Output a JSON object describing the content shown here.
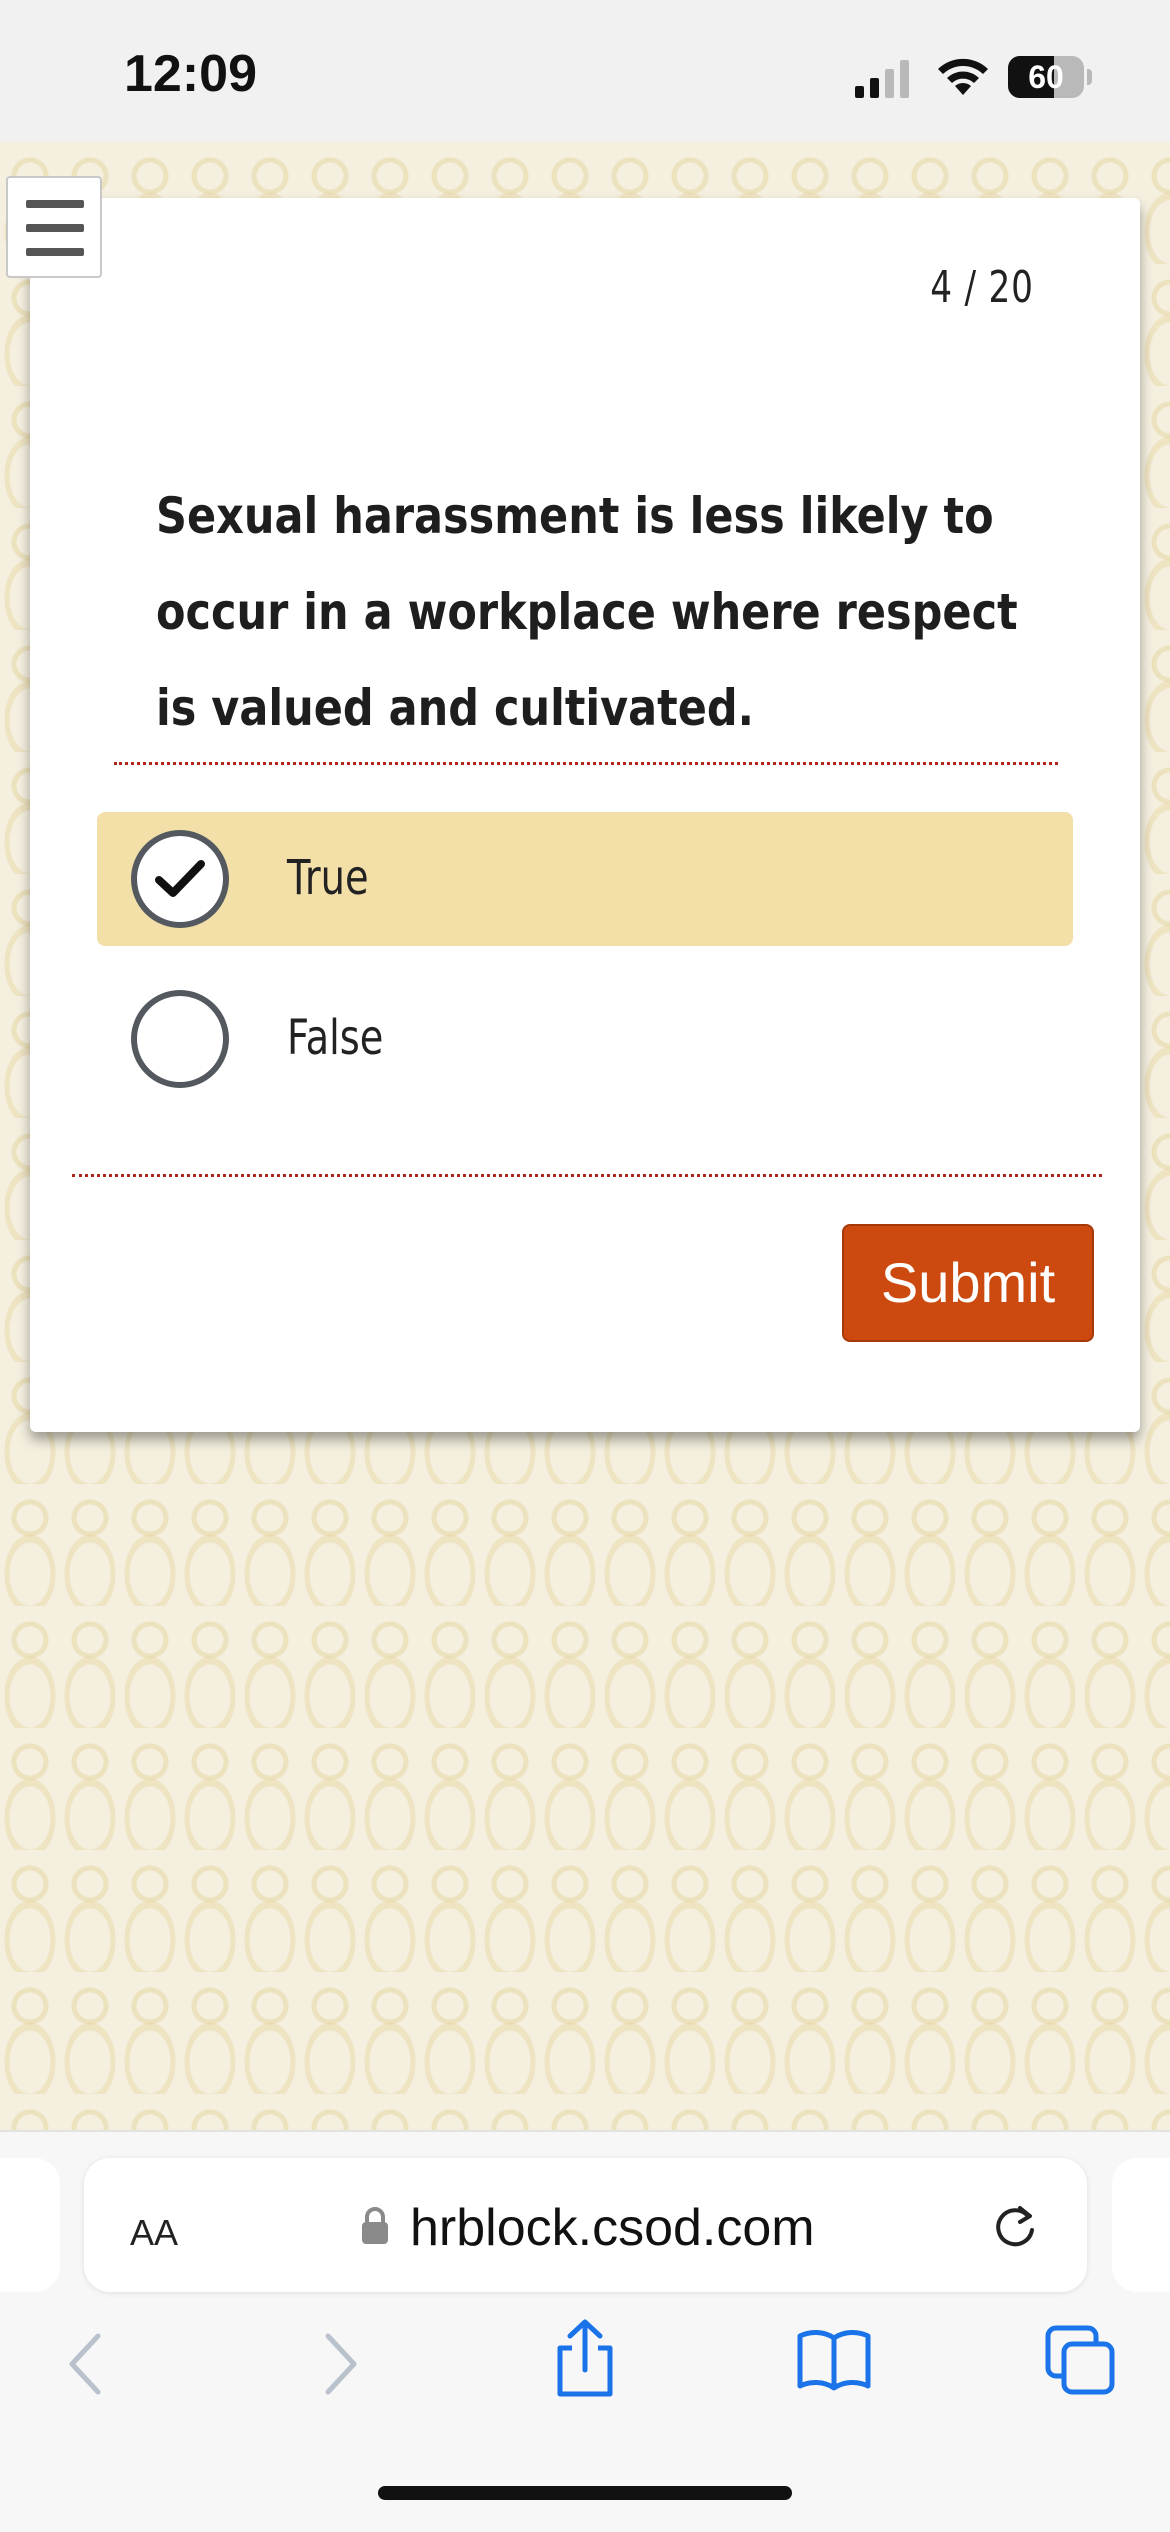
{
  "status_bar": {
    "time": "12:09",
    "battery_level": "60",
    "battery_percent": 60,
    "icons": [
      "signal-icon",
      "wifi-icon",
      "battery-icon"
    ]
  },
  "quiz": {
    "menu_icon": "hamburger-menu-icon",
    "progress": "4 / 20",
    "question_lines": [
      "Sexual harassment is less likely to",
      "occur in a workplace where respect",
      "is valued and cultivated."
    ],
    "options": [
      {
        "label": "True",
        "selected": true
      },
      {
        "label": "False",
        "selected": false
      }
    ],
    "submit_label": "Submit"
  },
  "browser": {
    "text_size_label": "AA",
    "url": "hrblock.csod.com",
    "icons": [
      "lock-icon",
      "reload-icon",
      "back-icon",
      "forward-icon",
      "share-icon",
      "bookmarks-icon",
      "tabs-icon"
    ]
  },
  "colors": {
    "accent_submit": "#cc4a0f",
    "selected_option": "#f3dfa8",
    "divider": "#b3261e",
    "ios_blue": "#1a73e8"
  }
}
